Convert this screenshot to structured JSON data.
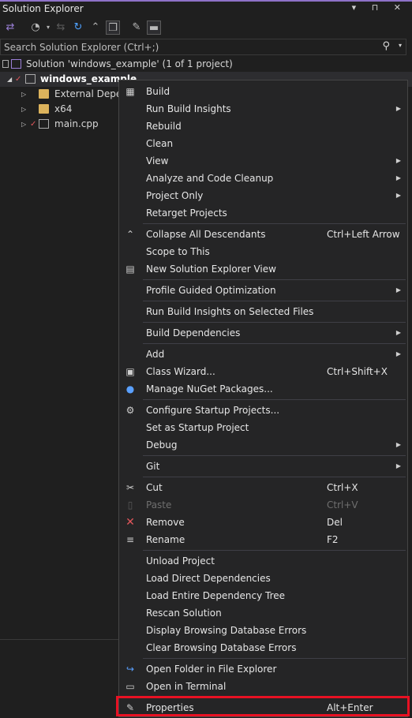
{
  "panel": {
    "title": "Solution Explorer",
    "title_controls": "▾ ⊓ ✕"
  },
  "search": {
    "placeholder": "Search Solution Explorer (Ctrl+;)"
  },
  "tree": {
    "solution": "Solution 'windows_example'   (1 of 1 project)",
    "project": "windows_example",
    "items": [
      "External Depen",
      "x64",
      "main.cpp"
    ]
  },
  "menu": {
    "items": [
      {
        "label": "Build",
        "shortcut": "",
        "submenu": false,
        "icon": "build-icon"
      },
      {
        "label": "Run Build Insights",
        "shortcut": "",
        "submenu": true,
        "icon": ""
      },
      {
        "label": "Rebuild",
        "shortcut": "",
        "submenu": false,
        "icon": ""
      },
      {
        "label": "Clean",
        "shortcut": "",
        "submenu": false,
        "icon": ""
      },
      {
        "label": "View",
        "shortcut": "",
        "submenu": true,
        "icon": ""
      },
      {
        "label": "Analyze and Code Cleanup",
        "shortcut": "",
        "submenu": true,
        "icon": ""
      },
      {
        "label": "Project Only",
        "shortcut": "",
        "submenu": true,
        "icon": ""
      },
      {
        "label": "Retarget Projects",
        "shortcut": "",
        "submenu": false,
        "icon": ""
      },
      {
        "label": "Collapse All Descendants",
        "shortcut": "Ctrl+Left Arrow",
        "submenu": false,
        "icon": "collapse-icon"
      },
      {
        "label": "Scope to This",
        "shortcut": "",
        "submenu": false,
        "icon": ""
      },
      {
        "label": "New Solution Explorer View",
        "shortcut": "",
        "submenu": false,
        "icon": "new-view-icon"
      },
      {
        "label": "Profile Guided Optimization",
        "shortcut": "",
        "submenu": true,
        "icon": ""
      },
      {
        "label": "Run Build Insights on Selected Files",
        "shortcut": "",
        "submenu": false,
        "icon": ""
      },
      {
        "label": "Build Dependencies",
        "shortcut": "",
        "submenu": true,
        "icon": ""
      },
      {
        "label": "Add",
        "shortcut": "",
        "submenu": true,
        "icon": ""
      },
      {
        "label": "Class Wizard...",
        "shortcut": "Ctrl+Shift+X",
        "submenu": false,
        "icon": "class-wizard-icon"
      },
      {
        "label": "Manage NuGet Packages...",
        "shortcut": "",
        "submenu": false,
        "icon": "nuget-icon"
      },
      {
        "label": "Configure Startup Projects...",
        "shortcut": "",
        "submenu": false,
        "icon": "gear-icon"
      },
      {
        "label": "Set as Startup Project",
        "shortcut": "",
        "submenu": false,
        "icon": ""
      },
      {
        "label": "Debug",
        "shortcut": "",
        "submenu": true,
        "icon": ""
      },
      {
        "label": "Git",
        "shortcut": "",
        "submenu": true,
        "icon": ""
      },
      {
        "label": "Cut",
        "shortcut": "Ctrl+X",
        "submenu": false,
        "icon": "scissors-icon"
      },
      {
        "label": "Paste",
        "shortcut": "Ctrl+V",
        "submenu": false,
        "icon": "paste-icon",
        "disabled": true
      },
      {
        "label": "Remove",
        "shortcut": "Del",
        "submenu": false,
        "icon": "remove-icon"
      },
      {
        "label": "Rename",
        "shortcut": "F2",
        "submenu": false,
        "icon": "rename-icon"
      },
      {
        "label": "Unload Project",
        "shortcut": "",
        "submenu": false,
        "icon": ""
      },
      {
        "label": "Load Direct Dependencies",
        "shortcut": "",
        "submenu": false,
        "icon": ""
      },
      {
        "label": "Load Entire Dependency Tree",
        "shortcut": "",
        "submenu": false,
        "icon": ""
      },
      {
        "label": "Rescan Solution",
        "shortcut": "",
        "submenu": false,
        "icon": ""
      },
      {
        "label": "Display Browsing Database Errors",
        "shortcut": "",
        "submenu": false,
        "icon": ""
      },
      {
        "label": "Clear Browsing Database Errors",
        "shortcut": "",
        "submenu": false,
        "icon": ""
      },
      {
        "label": "Open Folder in File Explorer",
        "shortcut": "",
        "submenu": false,
        "icon": "open-folder-icon"
      },
      {
        "label": "Open in Terminal",
        "shortcut": "",
        "submenu": false,
        "icon": "terminal-icon"
      },
      {
        "label": "Properties",
        "shortcut": "Alt+Enter",
        "submenu": false,
        "icon": "wrench-icon"
      }
    ]
  },
  "colors": {
    "background": "#1f1f1f",
    "menu_background": "#252526",
    "highlight_border": "#e81123",
    "accent": "#8e72c8"
  }
}
